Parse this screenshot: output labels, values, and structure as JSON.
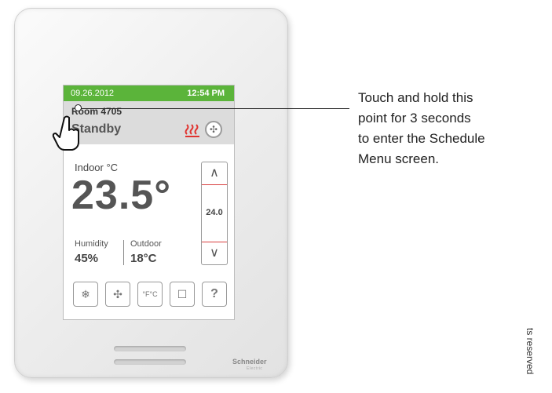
{
  "screen": {
    "date": "09.26.2012",
    "time": "12:54 PM",
    "room_name": "Room 4705",
    "mode": "Standby",
    "indoor_label": "Indoor °C",
    "indoor_temp": "23.5°",
    "setpoint": "24.0",
    "setpoint_up_label": "∧",
    "setpoint_down_label": "∨",
    "humidity_label": "Humidity",
    "humidity_value": "45%",
    "outdoor_label": "Outdoor",
    "outdoor_value": "18°C",
    "buttons": [
      {
        "icon": "heat-cool-mode-icon",
        "glyph": "❄"
      },
      {
        "icon": "fan-icon",
        "glyph": "✣"
      },
      {
        "icon": "unit-toggle-icon",
        "glyph": "°F°C"
      },
      {
        "icon": "message-icon",
        "glyph": "☐"
      },
      {
        "icon": "help-icon",
        "glyph": "?"
      }
    ],
    "accent_green": "#5bb43a",
    "heat_red": "#e0332f"
  },
  "device": {
    "brand": "Schneider",
    "brand_sub": "Electric"
  },
  "callout": {
    "lines": [
      "Touch and hold this",
      "point for 3 seconds",
      "to enter the Schedule",
      "Menu screen."
    ]
  },
  "side_note": "ts reserved"
}
